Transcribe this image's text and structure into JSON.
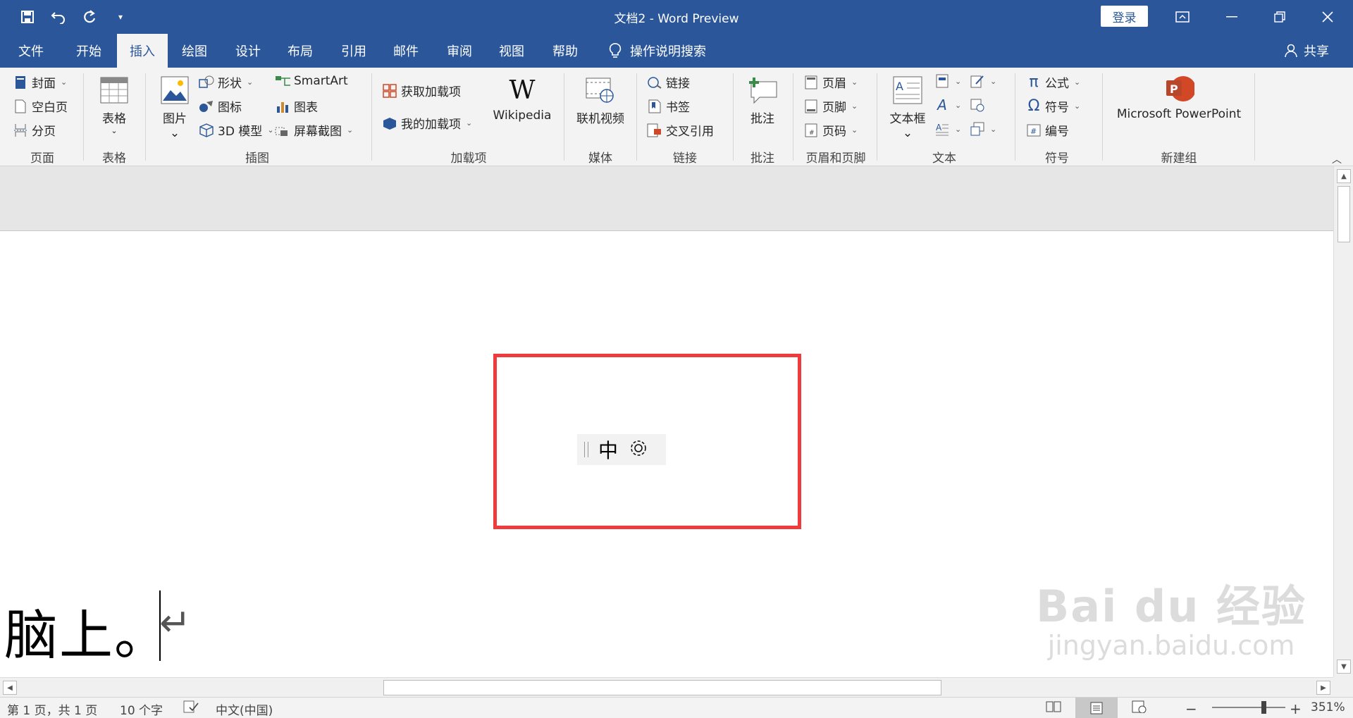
{
  "window": {
    "title": "文档2  -  Word Preview",
    "login": "登录",
    "qat_more": "▾"
  },
  "tabs": [
    "文件",
    "开始",
    "插入",
    "绘图",
    "设计",
    "布局",
    "引用",
    "邮件",
    "审阅",
    "视图",
    "帮助"
  ],
  "tellme": "操作说明搜索",
  "share": "共享",
  "ribbon": {
    "pages": {
      "cover": "封面",
      "blank": "空白页",
      "break": "分页",
      "label": "页面"
    },
    "tables": {
      "table": "表格",
      "label": "表格"
    },
    "illustrations": {
      "picture": "图片",
      "shapes": "形状",
      "icons": "图标",
      "model3d": "3D 模型",
      "smartart": "SmartArt",
      "chart": "图表",
      "screenshot": "屏幕截图",
      "label": "插图"
    },
    "addins": {
      "get": "获取加载项",
      "my": "我的加载项",
      "wiki": "Wikipedia",
      "wiki_logo": "W",
      "label": "加载项"
    },
    "media": {
      "video": "联机视频",
      "label": "媒体"
    },
    "links": {
      "link": "链接",
      "bookmark": "书签",
      "crossref": "交叉引用",
      "label": "链接"
    },
    "comments": {
      "comment": "批注",
      "label": "批注"
    },
    "header_footer": {
      "header": "页眉",
      "footer": "页脚",
      "page_number": "页码",
      "label": "页眉和页脚"
    },
    "text": {
      "textbox": "文本框",
      "label": "文本"
    },
    "symbols": {
      "equation": "公式",
      "symbol": "符号",
      "number": "编号",
      "label": "符号"
    },
    "newgroup": {
      "powerpoint": "Microsoft PowerPoint",
      "label": "新建组"
    }
  },
  "ime": {
    "mode": "中"
  },
  "document": {
    "text": "脑上。"
  },
  "watermark": {
    "line1": "Bai du 经验",
    "line2": "jingyan.baidu.com"
  },
  "status": {
    "page": "第 1 页，共 1 页",
    "words": "10 个字",
    "language": "中文(中国)",
    "zoom": "351%",
    "zoom_minus": "−",
    "zoom_plus": "+"
  },
  "colors": {
    "titlebar": "#2b579a",
    "highlight_box": "#ef3b3b",
    "ppt_icon": "#d24726"
  }
}
